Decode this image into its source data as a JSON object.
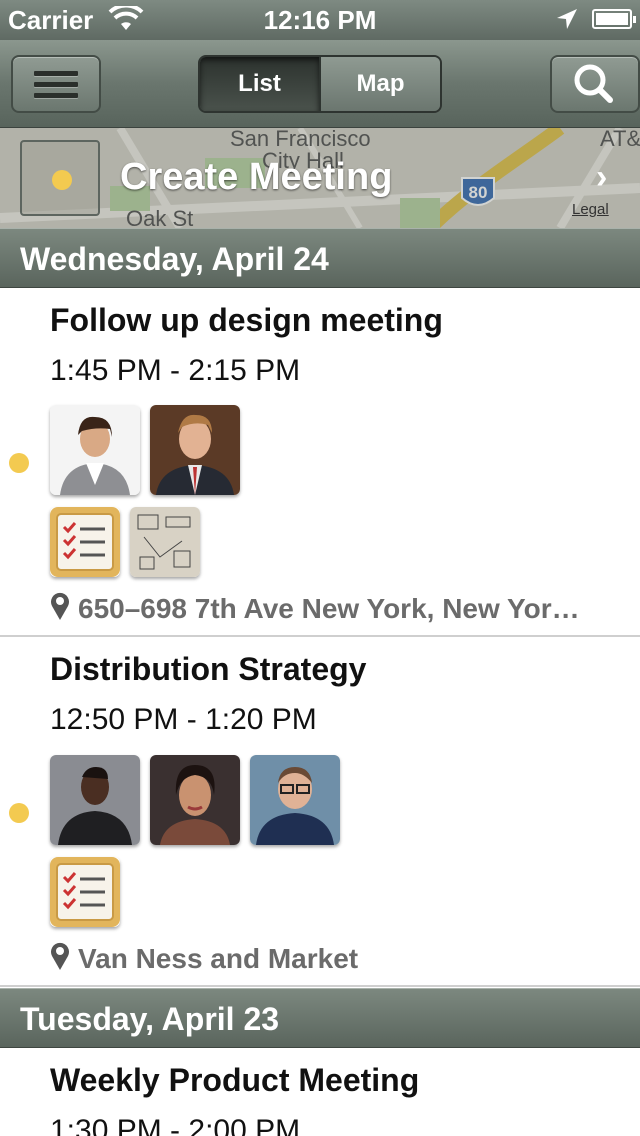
{
  "status_bar": {
    "carrier": "Carrier",
    "time": "12:16 PM"
  },
  "nav": {
    "segments": {
      "list": "List",
      "map": "Map"
    },
    "active_segment": "List"
  },
  "create_meeting": {
    "label": "Create Meeting",
    "map_legal": "Legal",
    "map_labels": [
      "San Francisco",
      "City Hall",
      "Oak St",
      "80",
      "AT&"
    ]
  },
  "sections": [
    {
      "header": "Wednesday, April 24",
      "meetings": [
        {
          "title": "Follow up design meeting",
          "time": "1:45 PM - 2:15 PM",
          "attendees": [
            "woman-businesswear-avatar",
            "man-suit-avatar"
          ],
          "attachments": [
            "checklist-icon",
            "whiteboard-photo"
          ],
          "location": "650–698 7th Ave New York, New Yor…"
        },
        {
          "title": "Distribution Strategy",
          "time": "12:50 PM - 1:20 PM",
          "attendees": [
            "man-coat-avatar",
            "woman-avatar",
            "man-glasses-avatar"
          ],
          "attachments": [
            "checklist-icon"
          ],
          "location": "Van Ness and Market"
        }
      ]
    },
    {
      "header": "Tuesday, April 23",
      "meetings": [
        {
          "title": "Weekly Product Meeting",
          "time": "1:30 PM - 2:00 PM"
        }
      ]
    }
  ],
  "colors": {
    "accent_dot": "#f3ca50",
    "bar": "#6a766e",
    "location_text": "#6b6b6b"
  }
}
